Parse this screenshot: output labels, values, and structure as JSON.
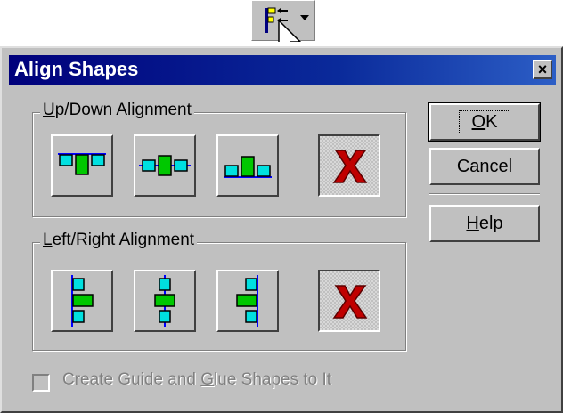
{
  "toolbar": {
    "align_button_icon": "align-shapes-icon",
    "dropdown_icon": "dropdown-arrow-icon"
  },
  "dialog": {
    "title": "Align Shapes",
    "close_label": "×"
  },
  "updown_group": {
    "label_mnemonic": "U",
    "label_rest": "p/Down Alignment",
    "buttons": [
      {
        "icon": "align-top-icon",
        "pressed": false
      },
      {
        "icon": "align-middle-icon",
        "pressed": false
      },
      {
        "icon": "align-bottom-icon",
        "pressed": false
      },
      {
        "icon": "no-alignment-icon",
        "pressed": true
      }
    ]
  },
  "leftright_group": {
    "label_mnemonic": "L",
    "label_rest": "eft/Right Alignment",
    "buttons": [
      {
        "icon": "align-left-icon",
        "pressed": false
      },
      {
        "icon": "align-center-icon",
        "pressed": false
      },
      {
        "icon": "align-right-icon",
        "pressed": false
      },
      {
        "icon": "no-alignment-icon",
        "pressed": true
      }
    ]
  },
  "buttons": {
    "ok_mnemonic": "O",
    "ok_rest": "K",
    "cancel": "Cancel",
    "help_mnemonic": "H",
    "help_rest": "elp"
  },
  "guide_checkbox": {
    "part1": "Create Guide and ",
    "mnemonic": "G",
    "part2": "lue Shapes to It",
    "checked": false,
    "enabled": false
  },
  "colors": {
    "title_bar": "#00007b",
    "shape_fill_cyan": "#00e0e0",
    "shape_fill_green": "#00c800",
    "guide_line_blue": "#0000ff",
    "cancel_x_red": "#c00000"
  }
}
